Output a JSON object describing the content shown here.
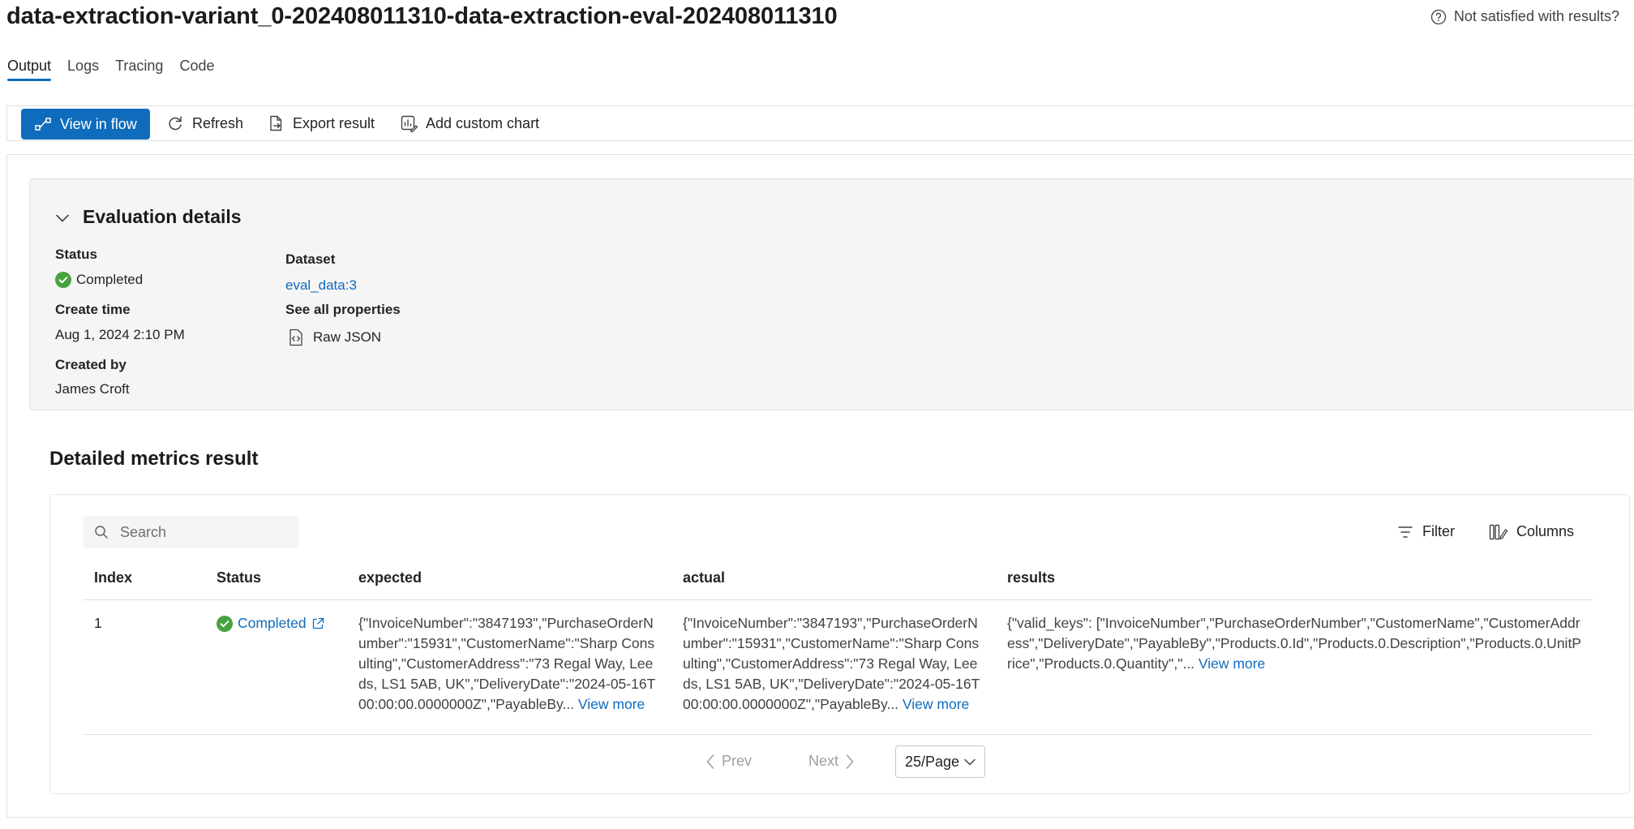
{
  "header": {
    "title": "data-extraction-variant_0-202408011310-data-extraction-eval-202408011310",
    "feedback_label": "Not satisfied with results?"
  },
  "tabs": [
    {
      "label": "Output",
      "active": true
    },
    {
      "label": "Logs",
      "active": false
    },
    {
      "label": "Tracing",
      "active": false
    },
    {
      "label": "Code",
      "active": false
    }
  ],
  "toolbar": {
    "view_in_flow": "View in flow",
    "refresh": "Refresh",
    "export_result": "Export result",
    "add_custom_chart": "Add custom chart"
  },
  "evaluation": {
    "title": "Evaluation details",
    "status_label": "Status",
    "status_value": "Completed",
    "create_time_label": "Create time",
    "create_time_value": "Aug 1, 2024 2:10 PM",
    "created_by_label": "Created by",
    "created_by_value": "James Croft",
    "dataset_label": "Dataset",
    "dataset_value": "eval_data:3",
    "properties_label": "See all properties",
    "raw_json": "Raw JSON"
  },
  "metrics": {
    "title": "Detailed metrics result",
    "search_placeholder": "Search",
    "filter": "Filter",
    "columns_button": "Columns",
    "columns": [
      "Index",
      "Status",
      "expected",
      "actual",
      "results"
    ],
    "rows": [
      {
        "index": "1",
        "status": "Completed",
        "expected": "{\"InvoiceNumber\":\"3847193\",\"PurchaseOrderNumber\":\"15931\",\"CustomerName\":\"Sharp Consulting\",\"CustomerAddress\":\"73 Regal Way, Leeds, LS1 5AB, UK\",\"DeliveryDate\":\"2024-05-16T00:00:00.0000000Z\",\"PayableBy...",
        "actual": "{\"InvoiceNumber\":\"3847193\",\"PurchaseOrderNumber\":\"15931\",\"CustomerName\":\"Sharp Consulting\",\"CustomerAddress\":\"73 Regal Way, Leeds, LS1 5AB, UK\",\"DeliveryDate\":\"2024-05-16T00:00:00.0000000Z\",\"PayableBy...",
        "results": "{\"valid_keys\": [\"InvoiceNumber\",\"PurchaseOrderNumber\",\"CustomerName\",\"CustomerAddress\",\"DeliveryDate\",\"PayableBy\",\"Products.0.Id\",\"Products.0.Description\",\"Products.0.UnitPrice\",\"Products.0.Quantity\",\"...",
        "view_more": "View more"
      }
    ],
    "pager": {
      "prev": "Prev",
      "next": "Next",
      "page_size": "25/Page"
    }
  },
  "colors": {
    "accent": "#0f6cbd",
    "success": "#47a23f"
  }
}
